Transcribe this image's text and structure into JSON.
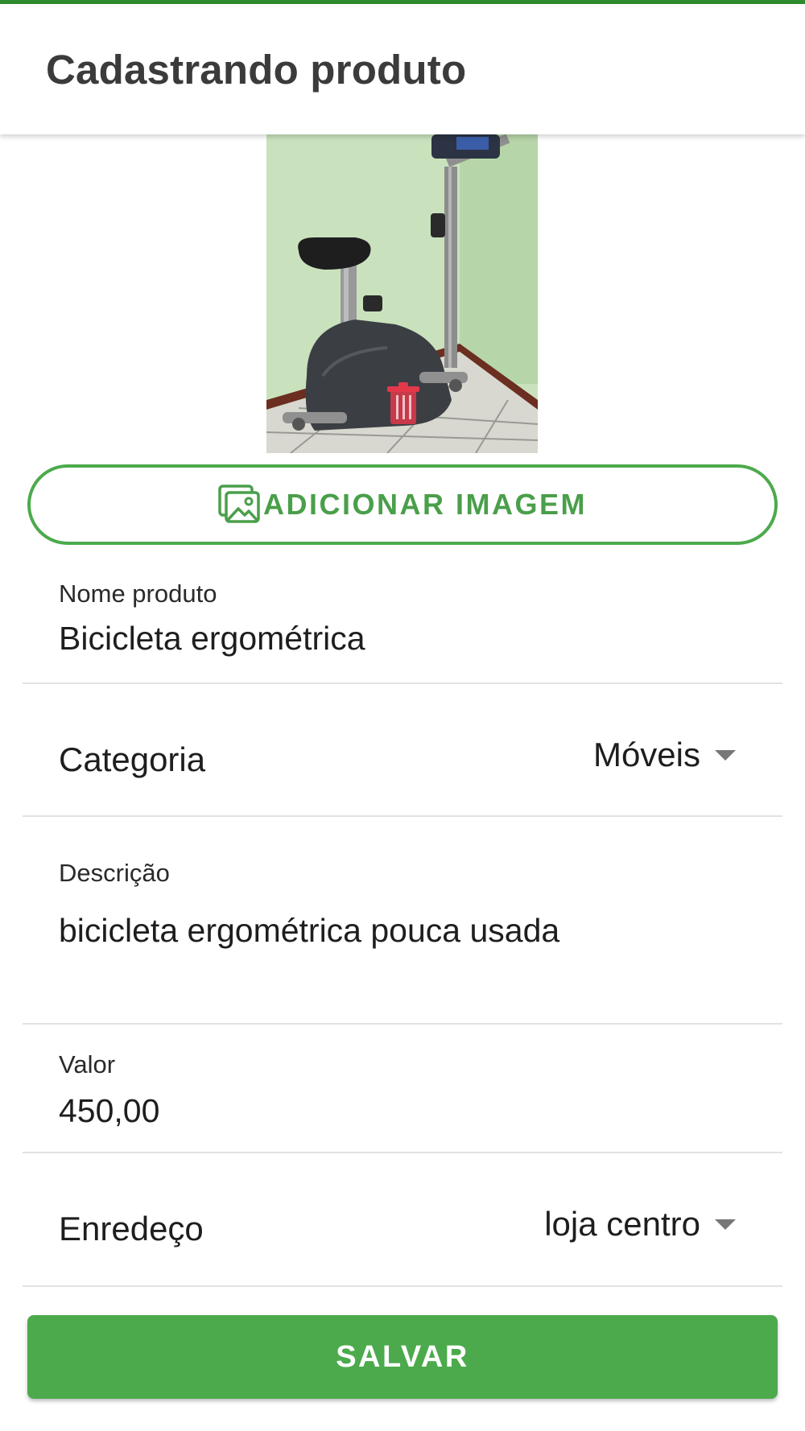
{
  "app_bar": {
    "title": "Cadastrando produto"
  },
  "image": {
    "alt": "Bicicleta ergométrica",
    "delete_icon": "trash-icon"
  },
  "add_image": {
    "label": "ADICIONAR IMAGEM",
    "icon": "add-photo-icon"
  },
  "form": {
    "name": {
      "label": "Nome produto",
      "value": "Bicicleta ergométrica"
    },
    "category": {
      "label": "Categoria",
      "value": "Móveis"
    },
    "description": {
      "label": "Descrição",
      "value": "bicicleta ergométrica pouca usada"
    },
    "price": {
      "label": "Valor",
      "value": "450,00"
    },
    "address": {
      "label": "Enredeço",
      "value": "loja centro"
    }
  },
  "save": {
    "label": "SALVAR"
  },
  "colors": {
    "accent": "#4caa4c",
    "top_bar": "#2e8b2e",
    "delete": "#e2384a"
  }
}
